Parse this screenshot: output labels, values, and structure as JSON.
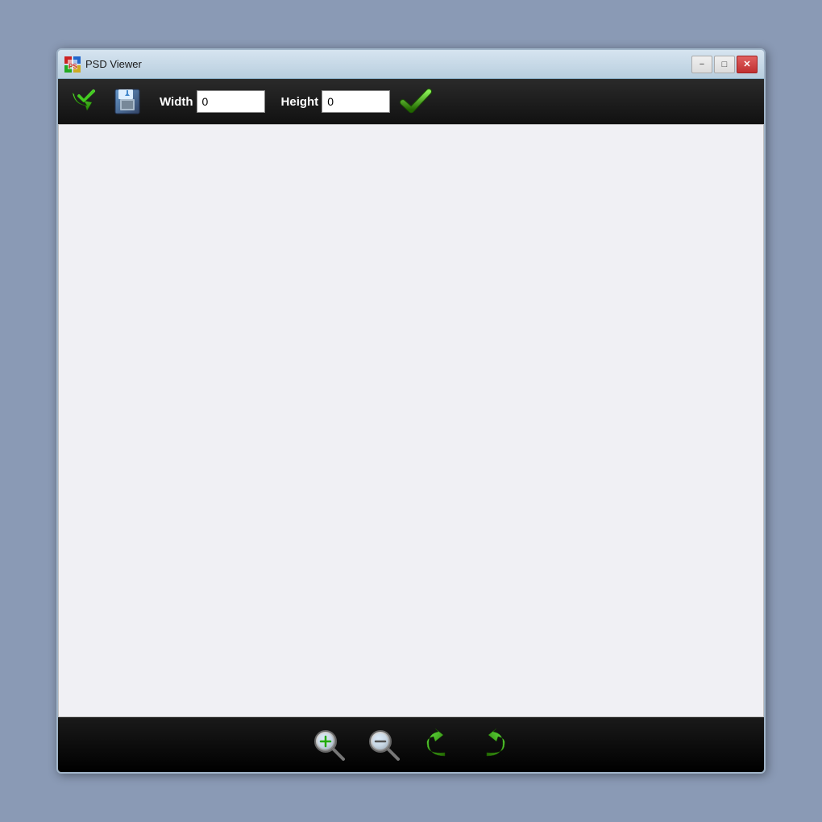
{
  "window": {
    "title": "PSD Viewer",
    "icon_label": "psd-viewer-icon"
  },
  "title_buttons": {
    "minimize_label": "−",
    "restore_label": "□",
    "close_label": "✕"
  },
  "toolbar": {
    "open_icon_label": "open-file-icon",
    "save_icon_label": "save-file-icon",
    "width_label": "Width",
    "width_value": "0",
    "height_label": "Height",
    "height_value": "0",
    "apply_icon_label": "apply-check-icon"
  },
  "bottom_toolbar": {
    "zoom_in_label": "zoom-in-icon",
    "zoom_out_label": "zoom-out-icon",
    "rotate_left_label": "rotate-left-icon",
    "rotate_right_label": "rotate-right-icon"
  }
}
